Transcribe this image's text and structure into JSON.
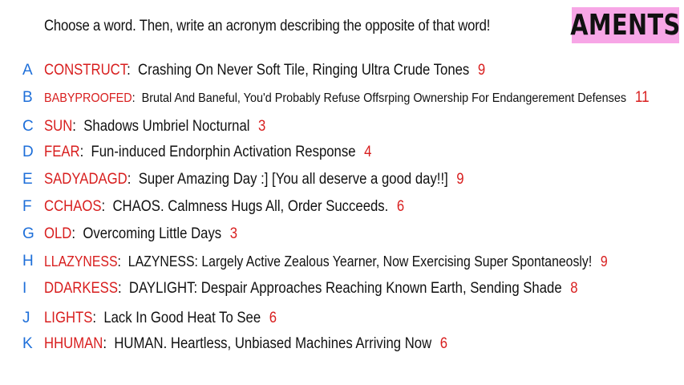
{
  "prompt": "Choose a word. Then, write an acronym describing the opposite of that word!",
  "logo_text": "AMENTS",
  "colors": {
    "letter": "#1e6fd9",
    "word": "#d81e1e",
    "logo_bg": "#f7a6e6"
  },
  "entries": [
    {
      "letter": "A",
      "word": "CONSTRUCT",
      "acronym": "Crashing On Never Soft Tile, Ringing Ultra Crude Tones",
      "score": "9"
    },
    {
      "letter": "B",
      "word": "BABYPROOFED",
      "acronym": "Brutal And Baneful, You'd Probably Refuse Offsrping Ownership For Endangerement Defenses",
      "score": "11"
    },
    {
      "letter": "C",
      "word": "SUN",
      "acronym": "Shadows Umbriel Nocturnal",
      "score": "3"
    },
    {
      "letter": "D",
      "word": "FEAR",
      "acronym": "Fun-induced Endorphin Activation Response",
      "score": "4"
    },
    {
      "letter": "E",
      "word": "SADYADAGD",
      "acronym": "Super Amazing Day :] [You all deserve a good day!!]",
      "score": "9"
    },
    {
      "letter": "F",
      "word": "CCHAOS",
      "acronym": "CHAOS. Calmness Hugs All, Order Succeeds.",
      "score": "6"
    },
    {
      "letter": "G",
      "word": "OLD",
      "acronym": "Overcoming Little Days",
      "score": "3"
    },
    {
      "letter": "H",
      "word": "LLAZYNESS",
      "acronym": "LAZYNESS: Largely Active Zealous Yearner, Now Exercising Super Spontaneosly!",
      "score": "9"
    },
    {
      "letter": "I",
      "word": "DDARKESS",
      "acronym": "DAYLIGHT: Despair Approaches Reaching Known Earth, Sending Shade",
      "score": "8"
    },
    {
      "letter": "J",
      "word": "LIGHTS",
      "acronym": "Lack In Good Heat To See",
      "score": "6"
    },
    {
      "letter": "K",
      "word": "HHUMAN",
      "acronym": "HUMAN. Heartless, Unbiased Machines Arriving Now",
      "score": "6"
    }
  ]
}
